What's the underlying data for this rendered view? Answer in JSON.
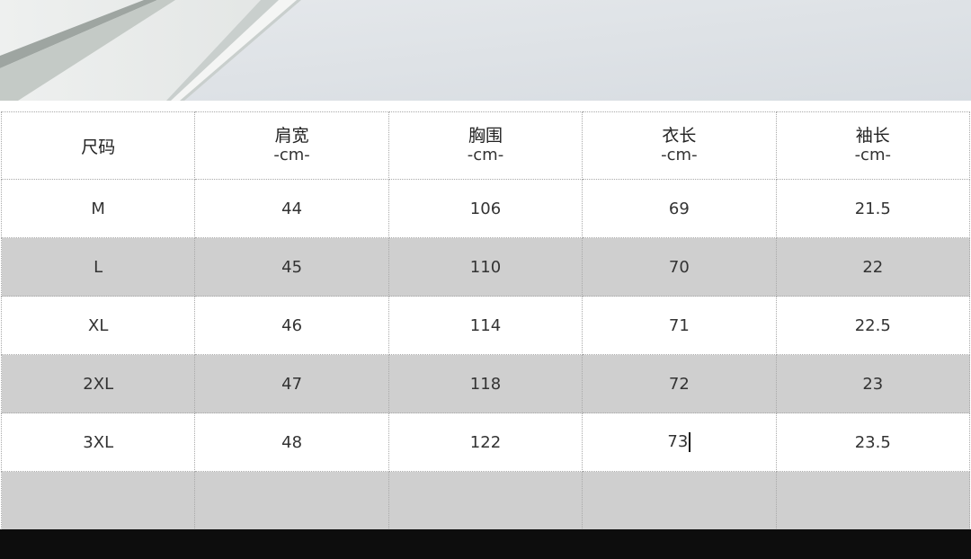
{
  "size_table": {
    "columns": [
      {
        "name": "尺码",
        "unit": ""
      },
      {
        "name": "肩宽",
        "unit": "-cm-"
      },
      {
        "name": "胸围",
        "unit": "-cm-"
      },
      {
        "name": "衣长",
        "unit": "-cm-"
      },
      {
        "name": "袖长",
        "unit": "-cm-"
      }
    ],
    "rows": [
      [
        "M",
        "44",
        "106",
        "69",
        "21.5"
      ],
      [
        "L",
        "45",
        "110",
        "70",
        "22"
      ],
      [
        "XL",
        "46",
        "114",
        "71",
        "22.5"
      ],
      [
        "2XL",
        "47",
        "118",
        "72",
        "23"
      ],
      [
        "3XL",
        "48",
        "122",
        "73",
        "23.5"
      ]
    ]
  },
  "colors": {
    "shaded_row": "#cfcfcf",
    "text": "#333333",
    "bottom_bar": "#0d0d0d"
  }
}
